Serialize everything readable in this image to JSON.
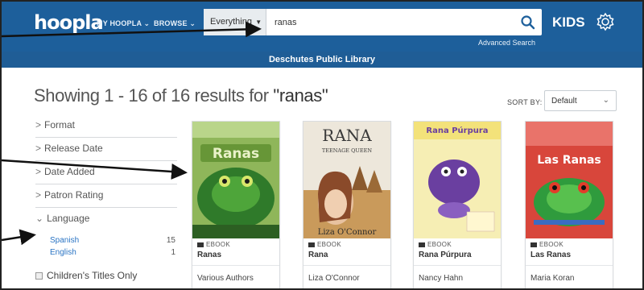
{
  "header": {
    "logo": "hoopla",
    "nav": [
      "MY HOOPLA",
      "BROWSE"
    ],
    "search_category": "Everything",
    "search_value": "ranas",
    "advanced_search": "Advanced Search",
    "kids": "KIDS"
  },
  "library": "Deschutes Public Library",
  "results": {
    "prefix": "Showing 1 - 16 of 16 results for ",
    "query": "\"ranas\""
  },
  "sort": {
    "label": "SORT BY:",
    "value": "Default"
  },
  "filters": [
    "Format",
    "Release Date",
    "Date Added",
    "Patron Rating",
    "Language"
  ],
  "languages": [
    {
      "label": "Spanish",
      "count": "15"
    },
    {
      "label": "English",
      "count": "1"
    }
  ],
  "childrens_only": "Children's Titles Only",
  "cards": [
    {
      "format": "EBOOK",
      "title": "Ranas",
      "author": "Various Authors",
      "cover_text": "Ranas",
      "cover_sub": "",
      "cover_color": "#6a9b3a"
    },
    {
      "format": "EBOOK",
      "title": "Rana",
      "author": "Liza O'Connor",
      "cover_text": "RANA",
      "cover_sub": "TEENAGE QUEEN",
      "cover_author": "Liza O'Connor",
      "cover_color": "#e9e3d8"
    },
    {
      "format": "EBOOK",
      "title": "Rana Púrpura",
      "author": "Nancy Hahn",
      "cover_text": "Rana Púrpura",
      "cover_sub": "",
      "cover_color": "#f4e9a8"
    },
    {
      "format": "EBOOK",
      "title": "Las Ranas",
      "author": "Maria Koran",
      "cover_text": "Las Ranas",
      "cover_sub": "",
      "cover_color": "#c53b33"
    }
  ],
  "colors": {
    "header": "#1d5f9b",
    "link": "#2a74c4"
  },
  "icons": [
    "search-icon",
    "gear-icon",
    "chevron-down-icon",
    "ebook-icon",
    "checkbox-icon"
  ]
}
